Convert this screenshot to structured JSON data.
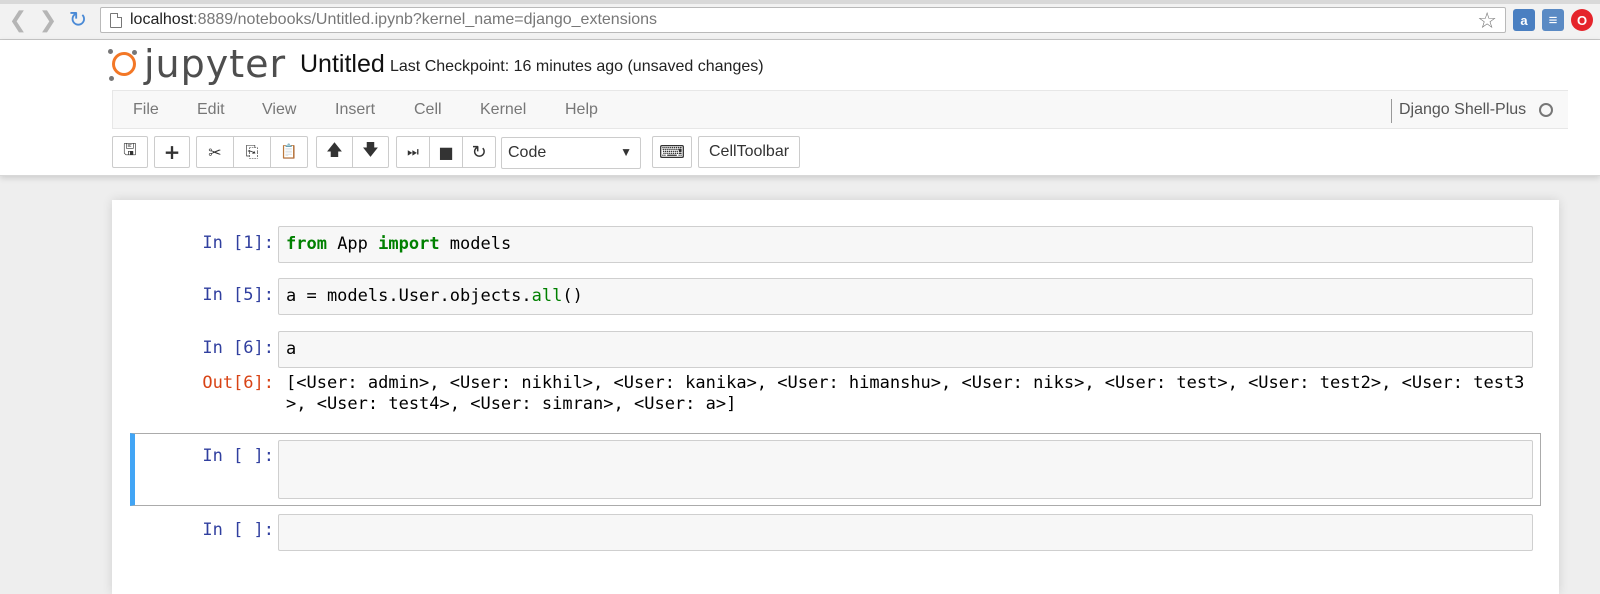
{
  "browser": {
    "url_host": "localhost",
    "url_rest": ":8889/notebooks/Untitled.ipynb?kernel_name=django_extensions",
    "back_glyph": "❮",
    "forward_glyph": "❯",
    "reload_glyph": "↻",
    "star_glyph": "☆",
    "extensions": [
      {
        "name": "amazon-extension-icon",
        "color": "#4a7fc1",
        "glyph": "a"
      },
      {
        "name": "translate-extension-icon",
        "color": "#3b6fb6",
        "glyph": "≡"
      },
      {
        "name": "opera-extension-icon",
        "color": "#e5242b",
        "glyph": "O"
      }
    ]
  },
  "header": {
    "logo_text": "jupyter",
    "notebook_title": "Untitled",
    "checkpoint": "Last Checkpoint: 16 minutes ago (unsaved changes)"
  },
  "menu": {
    "items": [
      "File",
      "Edit",
      "View",
      "Insert",
      "Cell",
      "Kernel",
      "Help"
    ],
    "kernel_name": "Django Shell-Plus"
  },
  "toolbar": {
    "cell_type": "Code",
    "cell_type_caret": "▼",
    "celltoolbar_label": "CellToolbar",
    "icons": {
      "save": "🖫",
      "add": "+",
      "cut": "✂",
      "copy": "⎘",
      "paste": "📋",
      "up": "🡅",
      "down": "🡇",
      "run": "⏭",
      "stop": "■",
      "restart": "↻",
      "keyboard": "⌨"
    }
  },
  "cells": [
    {
      "prompt": "In [1]:",
      "code_kw1": "from",
      "code_mid": " App ",
      "code_kw2": "import",
      "code_tail": " models"
    },
    {
      "prompt": "In [5]:",
      "code_head": "a = models.User.objects.",
      "code_fn": "all",
      "code_tail": "()"
    },
    {
      "prompt": "In [6]:",
      "code": "a",
      "out_prompt": "Out[6]:",
      "output": "[<User: admin>, <User: nikhil>, <User: kanika>, <User: himanshu>, <User: niks>, <User: test>, <User: test2>, <User: test3>, <User: test4>, <User: simran>, <User: a>]"
    },
    {
      "prompt": "In [ ]:",
      "code": ""
    },
    {
      "prompt": "In [ ]:",
      "code": ""
    }
  ]
}
